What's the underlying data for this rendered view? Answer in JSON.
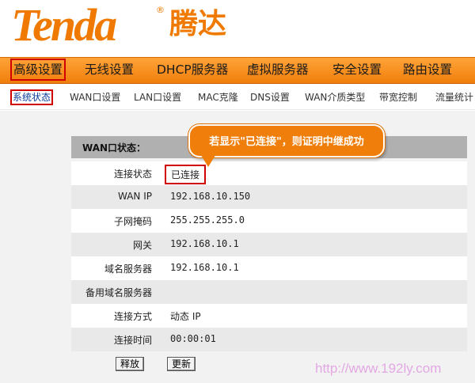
{
  "brand": {
    "name_en": "Tenda",
    "reg_mark": "®",
    "name_cn": "腾达"
  },
  "menu": {
    "items": [
      "高级设置",
      "无线设置",
      "DHCP服务器",
      "虚拟服务器",
      "安全设置",
      "路由设置"
    ],
    "active": "高级设置"
  },
  "submenu": {
    "items": [
      "系统状态",
      "WAN口设置",
      "LAN口设置",
      "MAC克隆",
      "DNS设置",
      "WAN介质类型",
      "带宽控制",
      "流量统计"
    ],
    "active": "系统状态"
  },
  "panel": {
    "title": "WAN口状态：",
    "rows": [
      {
        "label": "连接状态",
        "value": "已连接"
      },
      {
        "label": "WAN IP",
        "value": "192.168.10.150"
      },
      {
        "label": "子网掩码",
        "value": "255.255.255.0"
      },
      {
        "label": "网关",
        "value": "192.168.10.1"
      },
      {
        "label": "域名服务器",
        "value": "192.168.10.1"
      },
      {
        "label": "备用域名服务器",
        "value": ""
      },
      {
        "label": "连接方式",
        "value": "动态 IP"
      },
      {
        "label": "连接时间",
        "value": "00:00:01"
      }
    ]
  },
  "buttons": {
    "release": "释放",
    "refresh": "更新"
  },
  "callout": {
    "text": "若显示\"已连接\"，则证明中继成功"
  },
  "watermark": "http://www.192ly.com",
  "colors": {
    "brand_orange": "#f07a00",
    "highlight_red": "#d00000",
    "header_gray": "#b0b0b0"
  }
}
